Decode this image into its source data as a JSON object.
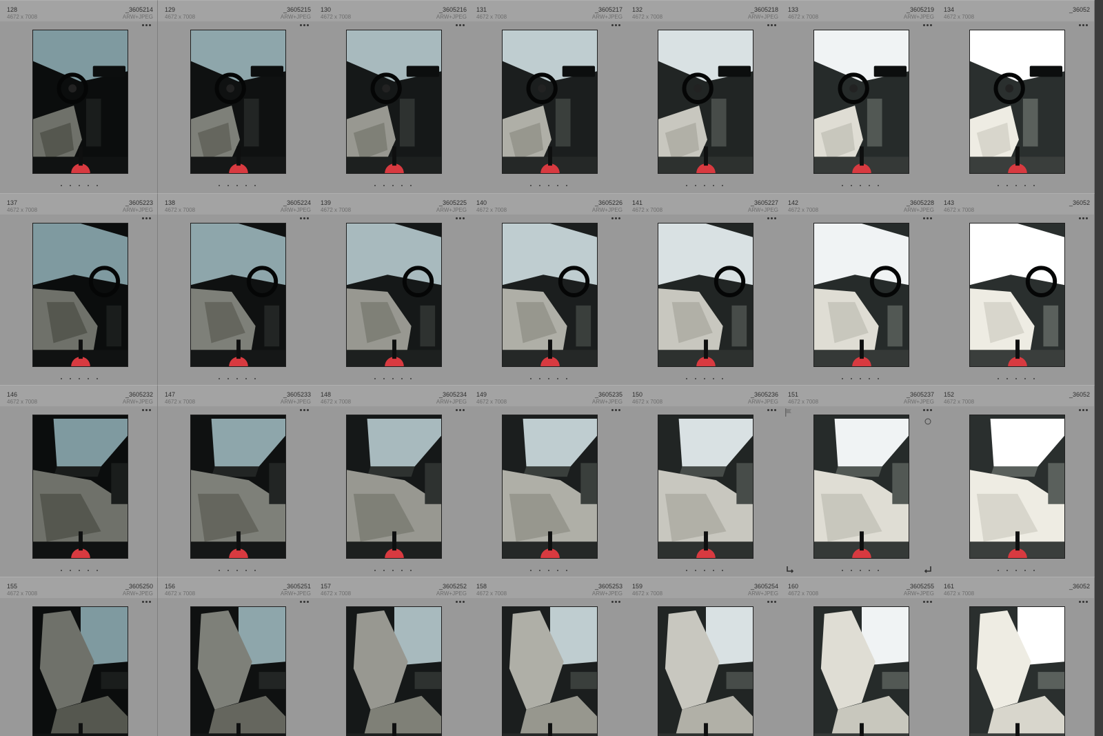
{
  "colors": {
    "cell_bg": "#999999",
    "header_bg": "#a3a3a3",
    "accent_red": "#d83a40"
  },
  "grid": {
    "rows": [
      [
        {
          "index": "128",
          "filename": "_3605214",
          "dims": "4672 x 7008",
          "format": "ARW+JPEG",
          "view": "dash",
          "bright": 0.0
        },
        {
          "index": "129",
          "filename": "_3605215",
          "dims": "4672 x 7008",
          "format": "ARW+JPEG",
          "view": "dash",
          "bright": 0.12
        },
        {
          "index": "130",
          "filename": "_3605216",
          "dims": "4672 x 7008",
          "format": "ARW+JPEG",
          "view": "dash",
          "bright": 0.32
        },
        {
          "index": "131",
          "filename": "_3605217",
          "dims": "4672 x 7008",
          "format": "ARW+JPEG",
          "view": "dash",
          "bright": 0.5
        },
        {
          "index": "132",
          "filename": "_3605218",
          "dims": "4672 x 7008",
          "format": "ARW+JPEG",
          "view": "dash",
          "bright": 0.7
        },
        {
          "index": "133",
          "filename": "_3605219",
          "dims": "4672 x 7008",
          "format": "ARW+JPEG",
          "view": "dash",
          "bright": 0.88
        },
        {
          "index": "134",
          "filename": "_36052",
          "dims": "4672 x 7008",
          "format": "",
          "view": "dash",
          "bright": 1.0
        }
      ],
      [
        {
          "index": "137",
          "filename": "_3605223",
          "dims": "4672 x 7008",
          "format": "ARW+JPEG",
          "view": "seat",
          "bright": 0.0
        },
        {
          "index": "138",
          "filename": "_3605224",
          "dims": "4672 x 7008",
          "format": "ARW+JPEG",
          "view": "seat",
          "bright": 0.12
        },
        {
          "index": "139",
          "filename": "_3605225",
          "dims": "4672 x 7008",
          "format": "ARW+JPEG",
          "view": "seat",
          "bright": 0.32
        },
        {
          "index": "140",
          "filename": "_3605226",
          "dims": "4672 x 7008",
          "format": "ARW+JPEG",
          "view": "seat",
          "bright": 0.5
        },
        {
          "index": "141",
          "filename": "_3605227",
          "dims": "4672 x 7008",
          "format": "ARW+JPEG",
          "view": "seat",
          "bright": 0.7
        },
        {
          "index": "142",
          "filename": "_3605228",
          "dims": "4672 x 7008",
          "format": "ARW+JPEG",
          "view": "seat",
          "bright": 0.88
        },
        {
          "index": "143",
          "filename": "_36052",
          "dims": "4672 x 7008",
          "format": "",
          "view": "seat",
          "bright": 1.0
        }
      ],
      [
        {
          "index": "146",
          "filename": "_3605232",
          "dims": "4672 x 7008",
          "format": "ARW+JPEG",
          "view": "door",
          "bright": 0.0
        },
        {
          "index": "147",
          "filename": "_3605233",
          "dims": "4672 x 7008",
          "format": "ARW+JPEG",
          "view": "door",
          "bright": 0.12
        },
        {
          "index": "148",
          "filename": "_3605234",
          "dims": "4672 x 7008",
          "format": "ARW+JPEG",
          "view": "door",
          "bright": 0.32
        },
        {
          "index": "149",
          "filename": "_3605235",
          "dims": "4672 x 7008",
          "format": "ARW+JPEG",
          "view": "door",
          "bright": 0.5
        },
        {
          "index": "150",
          "filename": "_3605236",
          "dims": "4672 x 7008",
          "format": "ARW+JPEG",
          "view": "door",
          "bright": 0.7
        },
        {
          "index": "151",
          "filename": "_3605237",
          "dims": "4672 x 7008",
          "format": "ARW+JPEG",
          "view": "door",
          "bright": 0.88,
          "hovered": true
        },
        {
          "index": "152",
          "filename": "_36052",
          "dims": "4672 x 7008",
          "format": "",
          "view": "door",
          "bright": 1.0
        }
      ],
      [
        {
          "index": "155",
          "filename": "_3605250",
          "dims": "4672 x 7008",
          "format": "ARW+JPEG",
          "view": "rear",
          "bright": 0.0
        },
        {
          "index": "156",
          "filename": "_3605251",
          "dims": "4672 x 7008",
          "format": "ARW+JPEG",
          "view": "rear",
          "bright": 0.12
        },
        {
          "index": "157",
          "filename": "_3605252",
          "dims": "4672 x 7008",
          "format": "ARW+JPEG",
          "view": "rear",
          "bright": 0.32
        },
        {
          "index": "158",
          "filename": "_3605253",
          "dims": "4672 x 7008",
          "format": "ARW+JPEG",
          "view": "rear",
          "bright": 0.5
        },
        {
          "index": "159",
          "filename": "_3605254",
          "dims": "4672 x 7008",
          "format": "ARW+JPEG",
          "view": "rear",
          "bright": 0.7
        },
        {
          "index": "160",
          "filename": "_3605255",
          "dims": "4672 x 7008",
          "format": "ARW+JPEG",
          "view": "rear",
          "bright": 0.88
        },
        {
          "index": "161",
          "filename": "_36052",
          "dims": "4672 x 7008",
          "format": "",
          "view": "rear",
          "bright": 1.0
        }
      ]
    ]
  }
}
